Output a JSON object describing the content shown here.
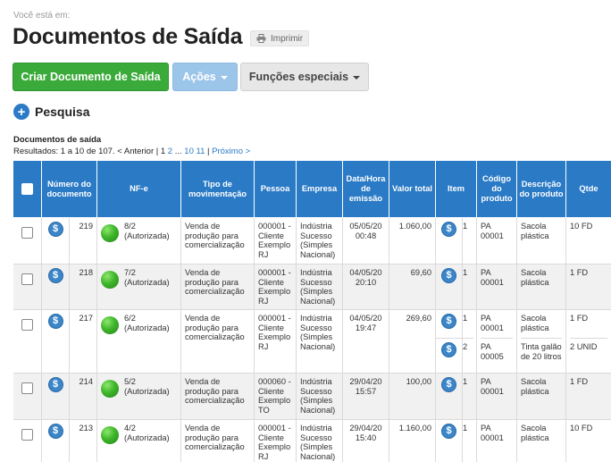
{
  "breadcrumb": "Você está em:",
  "page_title": "Documentos de Saída",
  "print_label": "Imprimir",
  "toolbar": {
    "create_label": "Criar Documento de Saída",
    "actions_label": "Ações",
    "special_label": "Funções especiais"
  },
  "search_label": "Pesquisa",
  "section_title": "Documentos de saída",
  "pagination": {
    "prefix": "Resultados: 1 a 10 de 107. < Anterior | 1",
    "page2": "2",
    "ellipsis": "...",
    "page10": "10",
    "page11": "11",
    "sep": "|",
    "next": "Próximo >"
  },
  "columns": {
    "numero": "Número do documento",
    "nfe": "NF-e",
    "tipo": "Tipo de movimentação",
    "pessoa": "Pessoa",
    "empresa": "Empresa",
    "data": "Data/Hora de emissão",
    "valor": "Valor total",
    "item": "Item",
    "codigo": "Código do produto",
    "descricao": "Descrição do produto",
    "qtde": "Qtde"
  },
  "rows": [
    {
      "numero": "219",
      "nfe": "8/2 (Autorizada)",
      "tipo": "Venda de produção para comercialização",
      "pessoa": "000001 - Cliente Exemplo RJ",
      "empresa": "Indústria Sucesso (Simples Nacional)",
      "data": "05/05/20 00:48",
      "valor": "1.060,00",
      "items": [
        {
          "n": "1",
          "codigo": "PA 00001",
          "descricao": "Sacola plástica",
          "qtde": "10 FD"
        }
      ]
    },
    {
      "numero": "218",
      "nfe": "7/2 (Autorizada)",
      "tipo": "Venda de produção para comercialização",
      "pessoa": "000001 - Cliente Exemplo RJ",
      "empresa": "Indústria Sucesso (Simples Nacional)",
      "data": "04/05/20 20:10",
      "valor": "69,60",
      "items": [
        {
          "n": "1",
          "codigo": "PA 00001",
          "descricao": "Sacola plástica",
          "qtde": "1 FD"
        }
      ]
    },
    {
      "numero": "217",
      "nfe": "6/2 (Autorizada)",
      "tipo": "Venda de produção para comercialização",
      "pessoa": "000001 - Cliente Exemplo RJ",
      "empresa": "Indústria Sucesso (Simples Nacional)",
      "data": "04/05/20 19:47",
      "valor": "269,60",
      "items": [
        {
          "n": "1",
          "codigo": "PA 00001",
          "descricao": "Sacola plástica",
          "qtde": "1 FD"
        },
        {
          "n": "2",
          "codigo": "PA 00005",
          "descricao": "Tinta galão de 20 litros",
          "qtde": "2 UNID"
        }
      ]
    },
    {
      "numero": "214",
      "nfe": "5/2 (Autorizada)",
      "tipo": "Venda de produção para comercialização",
      "pessoa": "000060 - Cliente Exemplo TO",
      "empresa": "Indústria Sucesso (Simples Nacional)",
      "data": "29/04/20 15:57",
      "valor": "100,00",
      "items": [
        {
          "n": "1",
          "codigo": "PA 00001",
          "descricao": "Sacola plástica",
          "qtde": "1 FD"
        }
      ]
    },
    {
      "numero": "213",
      "nfe": "4/2 (Autorizada)",
      "tipo": "Venda de produção para comercialização",
      "pessoa": "000001 - Cliente Exemplo RJ",
      "empresa": "Indústria Sucesso (Simples Nacional)",
      "data": "29/04/20 15:40",
      "valor": "1.160,00",
      "items": [
        {
          "n": "1",
          "codigo": "PA 00001",
          "descricao": "Sacola plástica",
          "qtde": "10 FD"
        }
      ]
    }
  ],
  "icons": {
    "dollar": "$",
    "plus": "+",
    "print": "printer-icon",
    "status": "status-authorized-icon"
  },
  "colors": {
    "header": "#2a7ac6",
    "create": "#3aab3a",
    "actions": "#9cc5ea",
    "status": "#3fb52b"
  }
}
